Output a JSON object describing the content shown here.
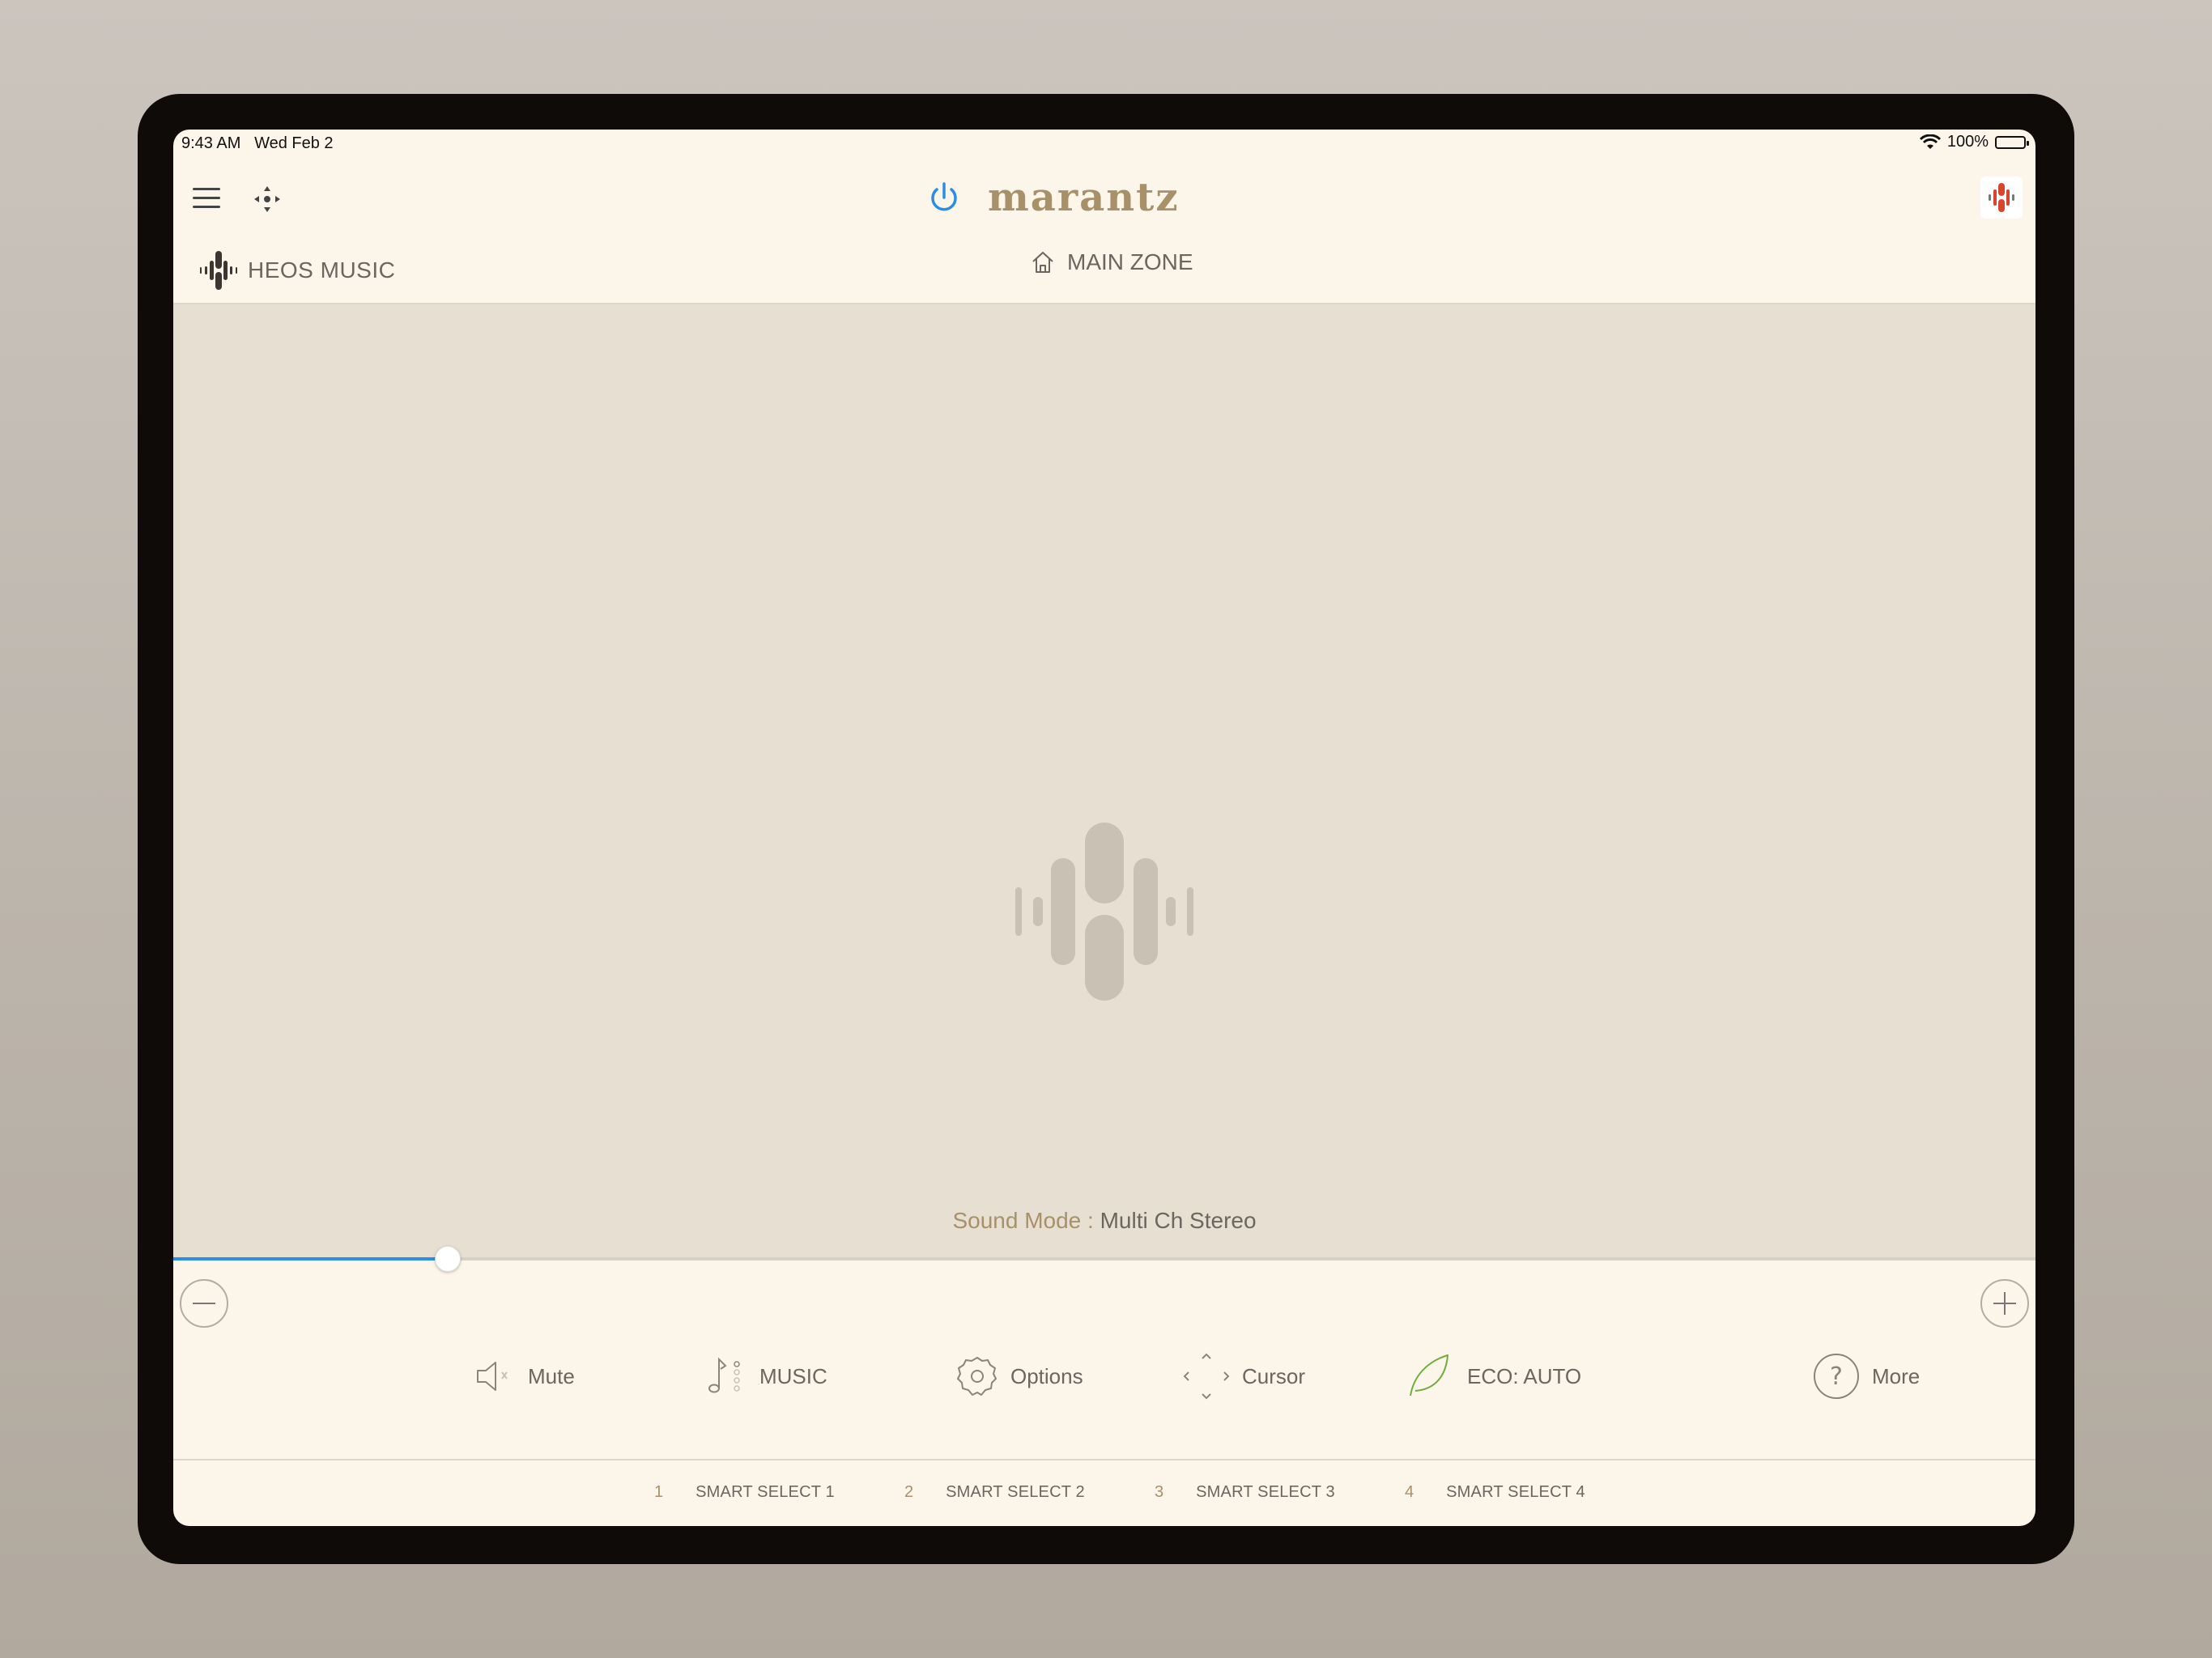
{
  "status_bar": {
    "time": "9:43 AM",
    "date": "Wed Feb 2",
    "battery": "100%"
  },
  "header": {
    "brand": "marantz",
    "power_color": "#2b8ee6"
  },
  "source": {
    "label": "HEOS MUSIC"
  },
  "zone": {
    "label": "MAIN ZONE"
  },
  "sound_mode": {
    "key": "Sound Mode : ",
    "value": "Multi Ch Stereo"
  },
  "volume": {
    "level_percent": 14.7
  },
  "controls": {
    "mute": "Mute",
    "music": "MUSIC",
    "options": "Options",
    "cursor": "Cursor",
    "eco": "ECO: AUTO",
    "more": "More"
  },
  "smart_select": [
    {
      "num": "1",
      "label": "SMART SELECT 1"
    },
    {
      "num": "2",
      "label": "SMART SELECT 2"
    },
    {
      "num": "3",
      "label": "SMART SELECT 3"
    },
    {
      "num": "4",
      "label": "SMART SELECT 4"
    }
  ],
  "colors": {
    "accent": "#2b8ee6",
    "brand": "#a89168",
    "eco": "#6fae3b",
    "background": "#fbf5ea"
  }
}
